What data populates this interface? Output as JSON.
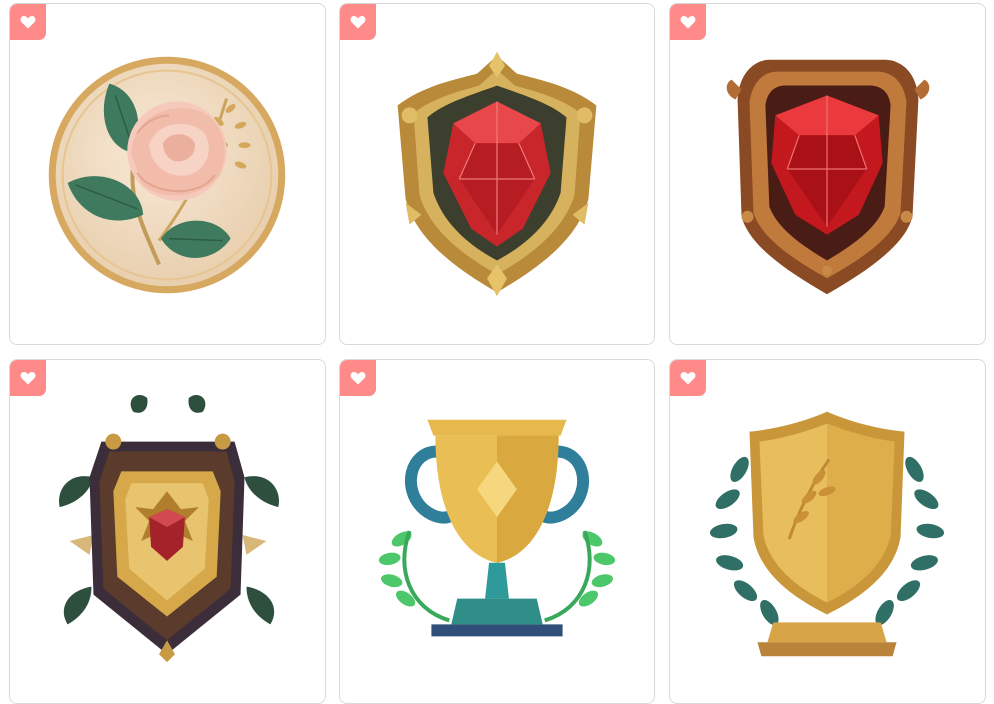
{
  "gallery": {
    "favorite_icon": "heart-icon",
    "favorite_color": "#ff8a8a",
    "items": [
      {
        "icon": "rose-medallion-icon"
      },
      {
        "icon": "ruby-shield-gold-icon"
      },
      {
        "icon": "ruby-shield-bronze-icon"
      },
      {
        "icon": "crest-shield-emblem-icon"
      },
      {
        "icon": "trophy-cup-laurel-icon"
      },
      {
        "icon": "gold-shield-laurel-icon"
      }
    ]
  }
}
